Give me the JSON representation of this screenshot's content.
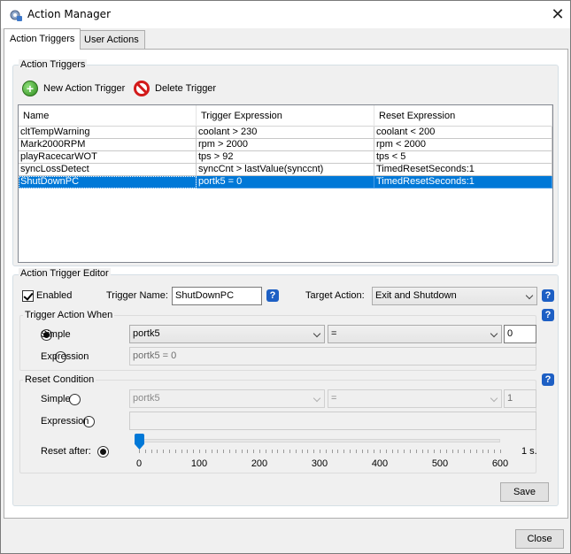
{
  "window": {
    "title": "Action Manager",
    "close_glyph": "✕",
    "app_icon": "gear-app-icon"
  },
  "tabs": [
    {
      "label": "Action Triggers",
      "active": true
    },
    {
      "label": "User Actions",
      "active": false
    }
  ],
  "triggers_group": {
    "label": "Action Triggers",
    "new_button": {
      "label": "New Action Trigger",
      "icon": "add-icon"
    },
    "delete_button": {
      "label": "Delete Trigger",
      "icon": "delete-icon"
    },
    "columns": [
      "Name",
      "Trigger Expression",
      "Reset Expression"
    ],
    "rows": [
      {
        "name": "cltTempWarning",
        "trigger": "coolant > 230",
        "reset": "coolant < 200",
        "selected": false
      },
      {
        "name": "Mark2000RPM",
        "trigger": "rpm > 2000",
        "reset": "rpm < 2000",
        "selected": false
      },
      {
        "name": "playRacecarWOT",
        "trigger": "tps > 92",
        "reset": "tps < 5",
        "selected": false
      },
      {
        "name": "syncLossDetect",
        "trigger": "syncCnt > lastValue(synccnt)",
        "reset": "TimedResetSeconds:1",
        "selected": false
      },
      {
        "name": "ShutDownPC",
        "trigger": "portk5 = 0",
        "reset": "TimedResetSeconds:1",
        "selected": true
      }
    ]
  },
  "editor": {
    "label": "Action Trigger Editor",
    "enabled_label": "Enabled",
    "enabled": true,
    "trigger_name_label": "Trigger Name:",
    "trigger_name_value": "ShutDownPC",
    "target_action_label": "Target Action:",
    "target_action_value": "Exit and Shutdown",
    "help_glyph": "?",
    "trigger_when": {
      "label": "Trigger Action When",
      "simple_label": "Simple",
      "simple_selected": true,
      "simple_field": "portk5",
      "simple_operator": "=",
      "simple_value": "0",
      "expression_label": "Expression",
      "expression_value": "portk5 = 0"
    },
    "reset_condition": {
      "label": "Reset Condition",
      "simple_label": "Simple",
      "simple_field": "portk5",
      "simple_operator": "=",
      "simple_value": "1",
      "expression_label": "Expression",
      "expression_value": "",
      "reset_after_label": "Reset after:",
      "reset_after_selected": true,
      "slider_value": 0,
      "slider_min": 0,
      "slider_max": 600,
      "slider_tick_labels": [
        "0",
        "100",
        "200",
        "300",
        "400",
        "500",
        "600"
      ],
      "slider_unit_label": "1 s."
    },
    "save_label": "Save"
  },
  "footer": {
    "close_label": "Close"
  }
}
